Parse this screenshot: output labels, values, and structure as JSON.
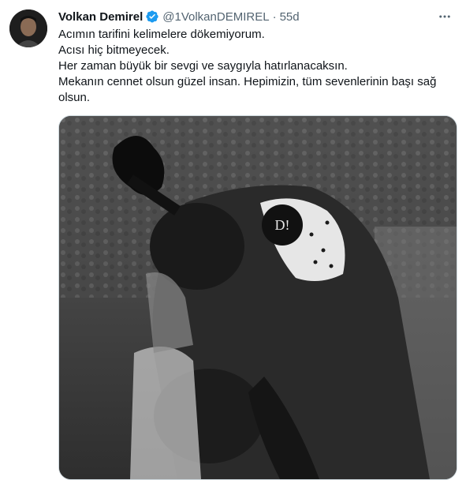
{
  "author": {
    "name": "Volkan Demirel",
    "handle": "@1VolkanDEMIREL",
    "separator": "·",
    "time": "55d",
    "verified": true
  },
  "tweet": {
    "lines": [
      "Acımın tarifini kelimelere dökemiyorum.",
      "Acısı hiç bitmeyecek.",
      "Her zaman büyük bir sevgi ve saygıyla hatırlanacaksın.",
      "Mekanın cennet olsun güzel insan. Hepimizin, tüm sevenlerinin başı sağ olsun."
    ]
  },
  "icons": {
    "more": "more-horizontal-icon",
    "verified": "verified-badge-icon"
  },
  "colors": {
    "verified_blue": "#1d9bf0",
    "secondary_text": "#536471"
  },
  "media": {
    "type": "photo",
    "style": "black-and-white",
    "badge_text": "D!"
  }
}
